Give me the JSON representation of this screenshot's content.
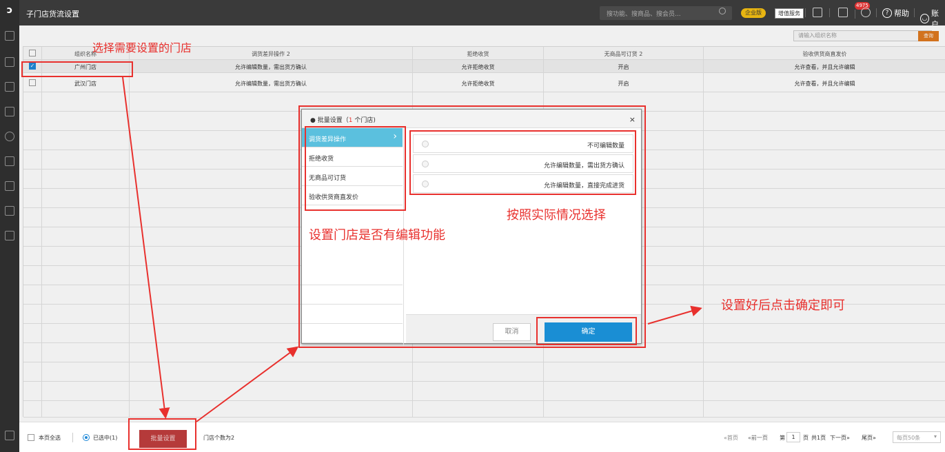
{
  "topbar": {
    "title": "子门店货流设置",
    "search_placeholder": "搜功能、搜商品、搜会员...",
    "enterprise_badge": "企业版",
    "value_added_label": "增值服务",
    "notification_count": "4975",
    "help_label": "帮助",
    "account_label": "账户"
  },
  "main": {
    "org_search_placeholder": "请输入组织名称",
    "query_label": "查询"
  },
  "table": {
    "headers": [
      "组织名称",
      "调货差异操作",
      "拒绝收货",
      "无商品可订货",
      "验收供货商直发价"
    ],
    "header_count_a": "2",
    "header_count_c": "2",
    "rows": [
      {
        "checked": true,
        "name": "广州门店",
        "diff_op": "允许编辑数量，需出货方确认",
        "reject": "允许拒绝收货",
        "no_goods": "开启",
        "acceptance": "允许查看，并且允许编辑"
      },
      {
        "checked": false,
        "name": "武汉门店",
        "diff_op": "允许编辑数量，需出货方确认",
        "reject": "允许拒绝收货",
        "no_goods": "开启",
        "acceptance": "允许查看，并且允许编辑"
      }
    ]
  },
  "footer": {
    "select_all": "本页全选",
    "selected": "已选中(1)",
    "batch_button": "批量设置",
    "store_count": "门店个数为2",
    "first": "«首页",
    "prev": "«前一页",
    "page_prefix": "第",
    "page_num": "1",
    "page_suffix": "页",
    "total": "共1页",
    "next": "下一页»",
    "last": "尾页»",
    "per_page": "每页50条"
  },
  "modal": {
    "title_prefix": "● 批量设置（",
    "title_count": "1",
    "title_suffix": " 个门店)",
    "close": "×",
    "tabs": [
      "调货差异操作",
      "拒绝收货",
      "无商品可订货",
      "验收供货商直发价"
    ],
    "options": [
      "不可编辑数量",
      "允许编辑数量，需出货方确认",
      "允许编辑数量，直接完成进货"
    ],
    "cancel": "取消",
    "confirm": "确定"
  },
  "annotations": {
    "select_store": "选择需要设置的门店",
    "choose_actual": "按照实际情况选择",
    "set_edit": "设置门店是否有编辑功能",
    "click_confirm": "设置好后点击确定即可"
  },
  "colors": {
    "annotation": "#e8302d",
    "accent": "#1a8ed4",
    "active_tab": "#5bc0de",
    "batch_btn": "#b53a3a"
  }
}
